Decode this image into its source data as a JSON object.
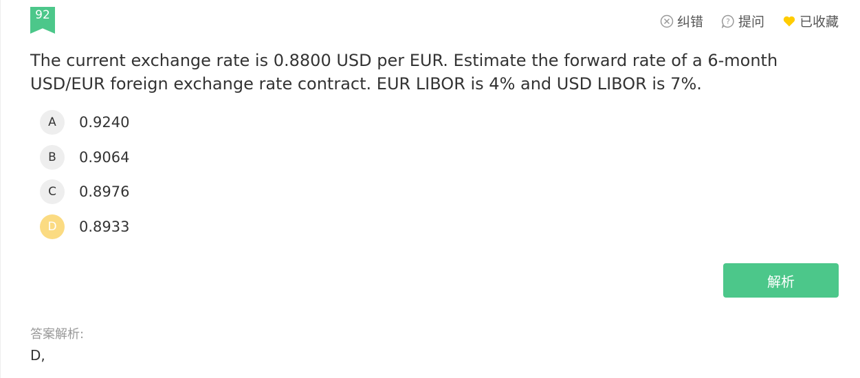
{
  "question_number": "92",
  "header_actions": {
    "report_label": "纠错",
    "ask_label": "提问",
    "favorite_label": "已收藏"
  },
  "question_text": "The current exchange rate is 0.8800 USD per EUR. Estimate the forward rate of a 6-month USD/EUR foreign exchange rate contract. EUR LIBOR is 4% and USD LIBOR is 7%.",
  "options": [
    {
      "letter": "A",
      "text": "0.9240"
    },
    {
      "letter": "B",
      "text": "0.9064"
    },
    {
      "letter": "C",
      "text": "0.8976"
    },
    {
      "letter": "D",
      "text": "0.8933"
    }
  ],
  "selected_option": "D",
  "analyze_button_label": "解析",
  "analysis": {
    "label": "答案解析:",
    "text": "D,"
  },
  "colors": {
    "accent_green": "#4cc78a",
    "selected_option": "#fbdb82",
    "favorite_heart": "#ffcc00"
  },
  "icons": {
    "report": "circle-x-icon",
    "ask": "question-bubble-icon",
    "favorite": "heart-icon"
  }
}
